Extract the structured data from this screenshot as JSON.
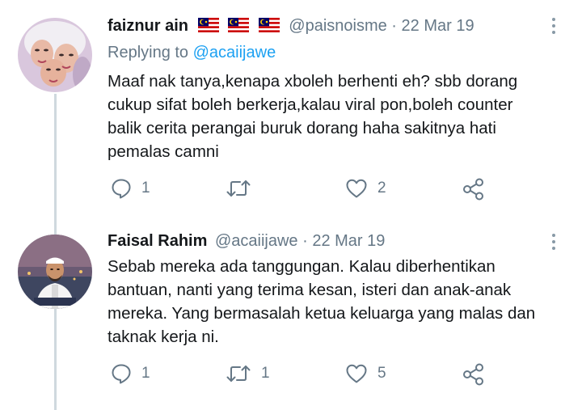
{
  "tweets": [
    {
      "name": "faiznur ain",
      "flags": [
        "malaysia-flag",
        "malaysia-flag",
        "malaysia-flag"
      ],
      "handle": "@paisnoisme",
      "separator": "·",
      "date": "22 Mar 19",
      "replying_prefix": "Replying to",
      "replying_to": "@acaiijawe",
      "lines": [
        "Maaf nak tanya,kenapa xboleh berhenti eh? sbb dorang",
        "cukup sifat boleh berkerja,kalau viral pon,boleh counter",
        "balik cerita perangai buruk dorang haha sakitnya hati",
        "pemalas camni"
      ],
      "reply_count": "1",
      "retweet_count": "",
      "like_count": "2"
    },
    {
      "name": "Faisal Rahim",
      "handle": "@acaiijawe",
      "separator": "·",
      "date": "22 Mar 19",
      "lines": [
        "Sebab mereka ada tanggungan. Kalau diberhentikan",
        "bantuan, nanti yang terima kesan, isteri dan anak-anak",
        "mereka. Yang bermasalah ketua keluarga yang malas dan",
        "taknak kerja ni."
      ],
      "reply_count": "1",
      "retweet_count": "1",
      "like_count": "5"
    }
  ],
  "colors": {
    "text": "#14171a",
    "muted": "#657786",
    "link": "#1da1f2",
    "thread_line": "#cfd9de"
  },
  "icons": [
    "reply-icon",
    "retweet-icon",
    "like-icon",
    "share-icon",
    "more-options-icon"
  ]
}
